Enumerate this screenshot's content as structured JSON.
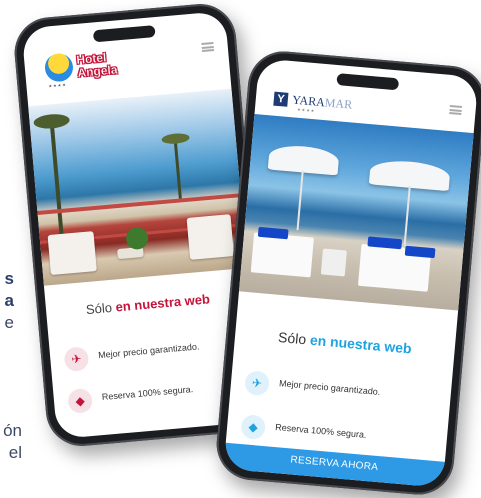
{
  "left_text": {
    "line1": "s",
    "line2": "a",
    "line3": "e",
    "line4": "ón",
    "line5": "el"
  },
  "phone1": {
    "logo": {
      "name_line1": "Hotel",
      "name_line2": "Angela",
      "stars": "★★★★"
    },
    "tagline_prefix": "Sólo",
    "tagline_highlight": "en nuestra web",
    "features": [
      {
        "icon": "plane-ticket-icon",
        "label": "Mejor precio garantizado."
      },
      {
        "icon": "shield-tag-icon",
        "label": "Reserva 100% segura."
      }
    ],
    "accent": "#c4143a"
  },
  "phone2": {
    "logo": {
      "brand_main": "YARA",
      "brand_accent": "MAR",
      "stars": "★★★★"
    },
    "tagline_prefix": "Sólo",
    "tagline_highlight": "en nuestra web",
    "features": [
      {
        "icon": "plane-ticket-icon",
        "label": "Mejor precio garantizado."
      },
      {
        "icon": "shield-tag-icon",
        "label": "Reserva 100% segura."
      }
    ],
    "cta_label": "RESERVA AHORA",
    "accent": "#1fa3e0"
  }
}
